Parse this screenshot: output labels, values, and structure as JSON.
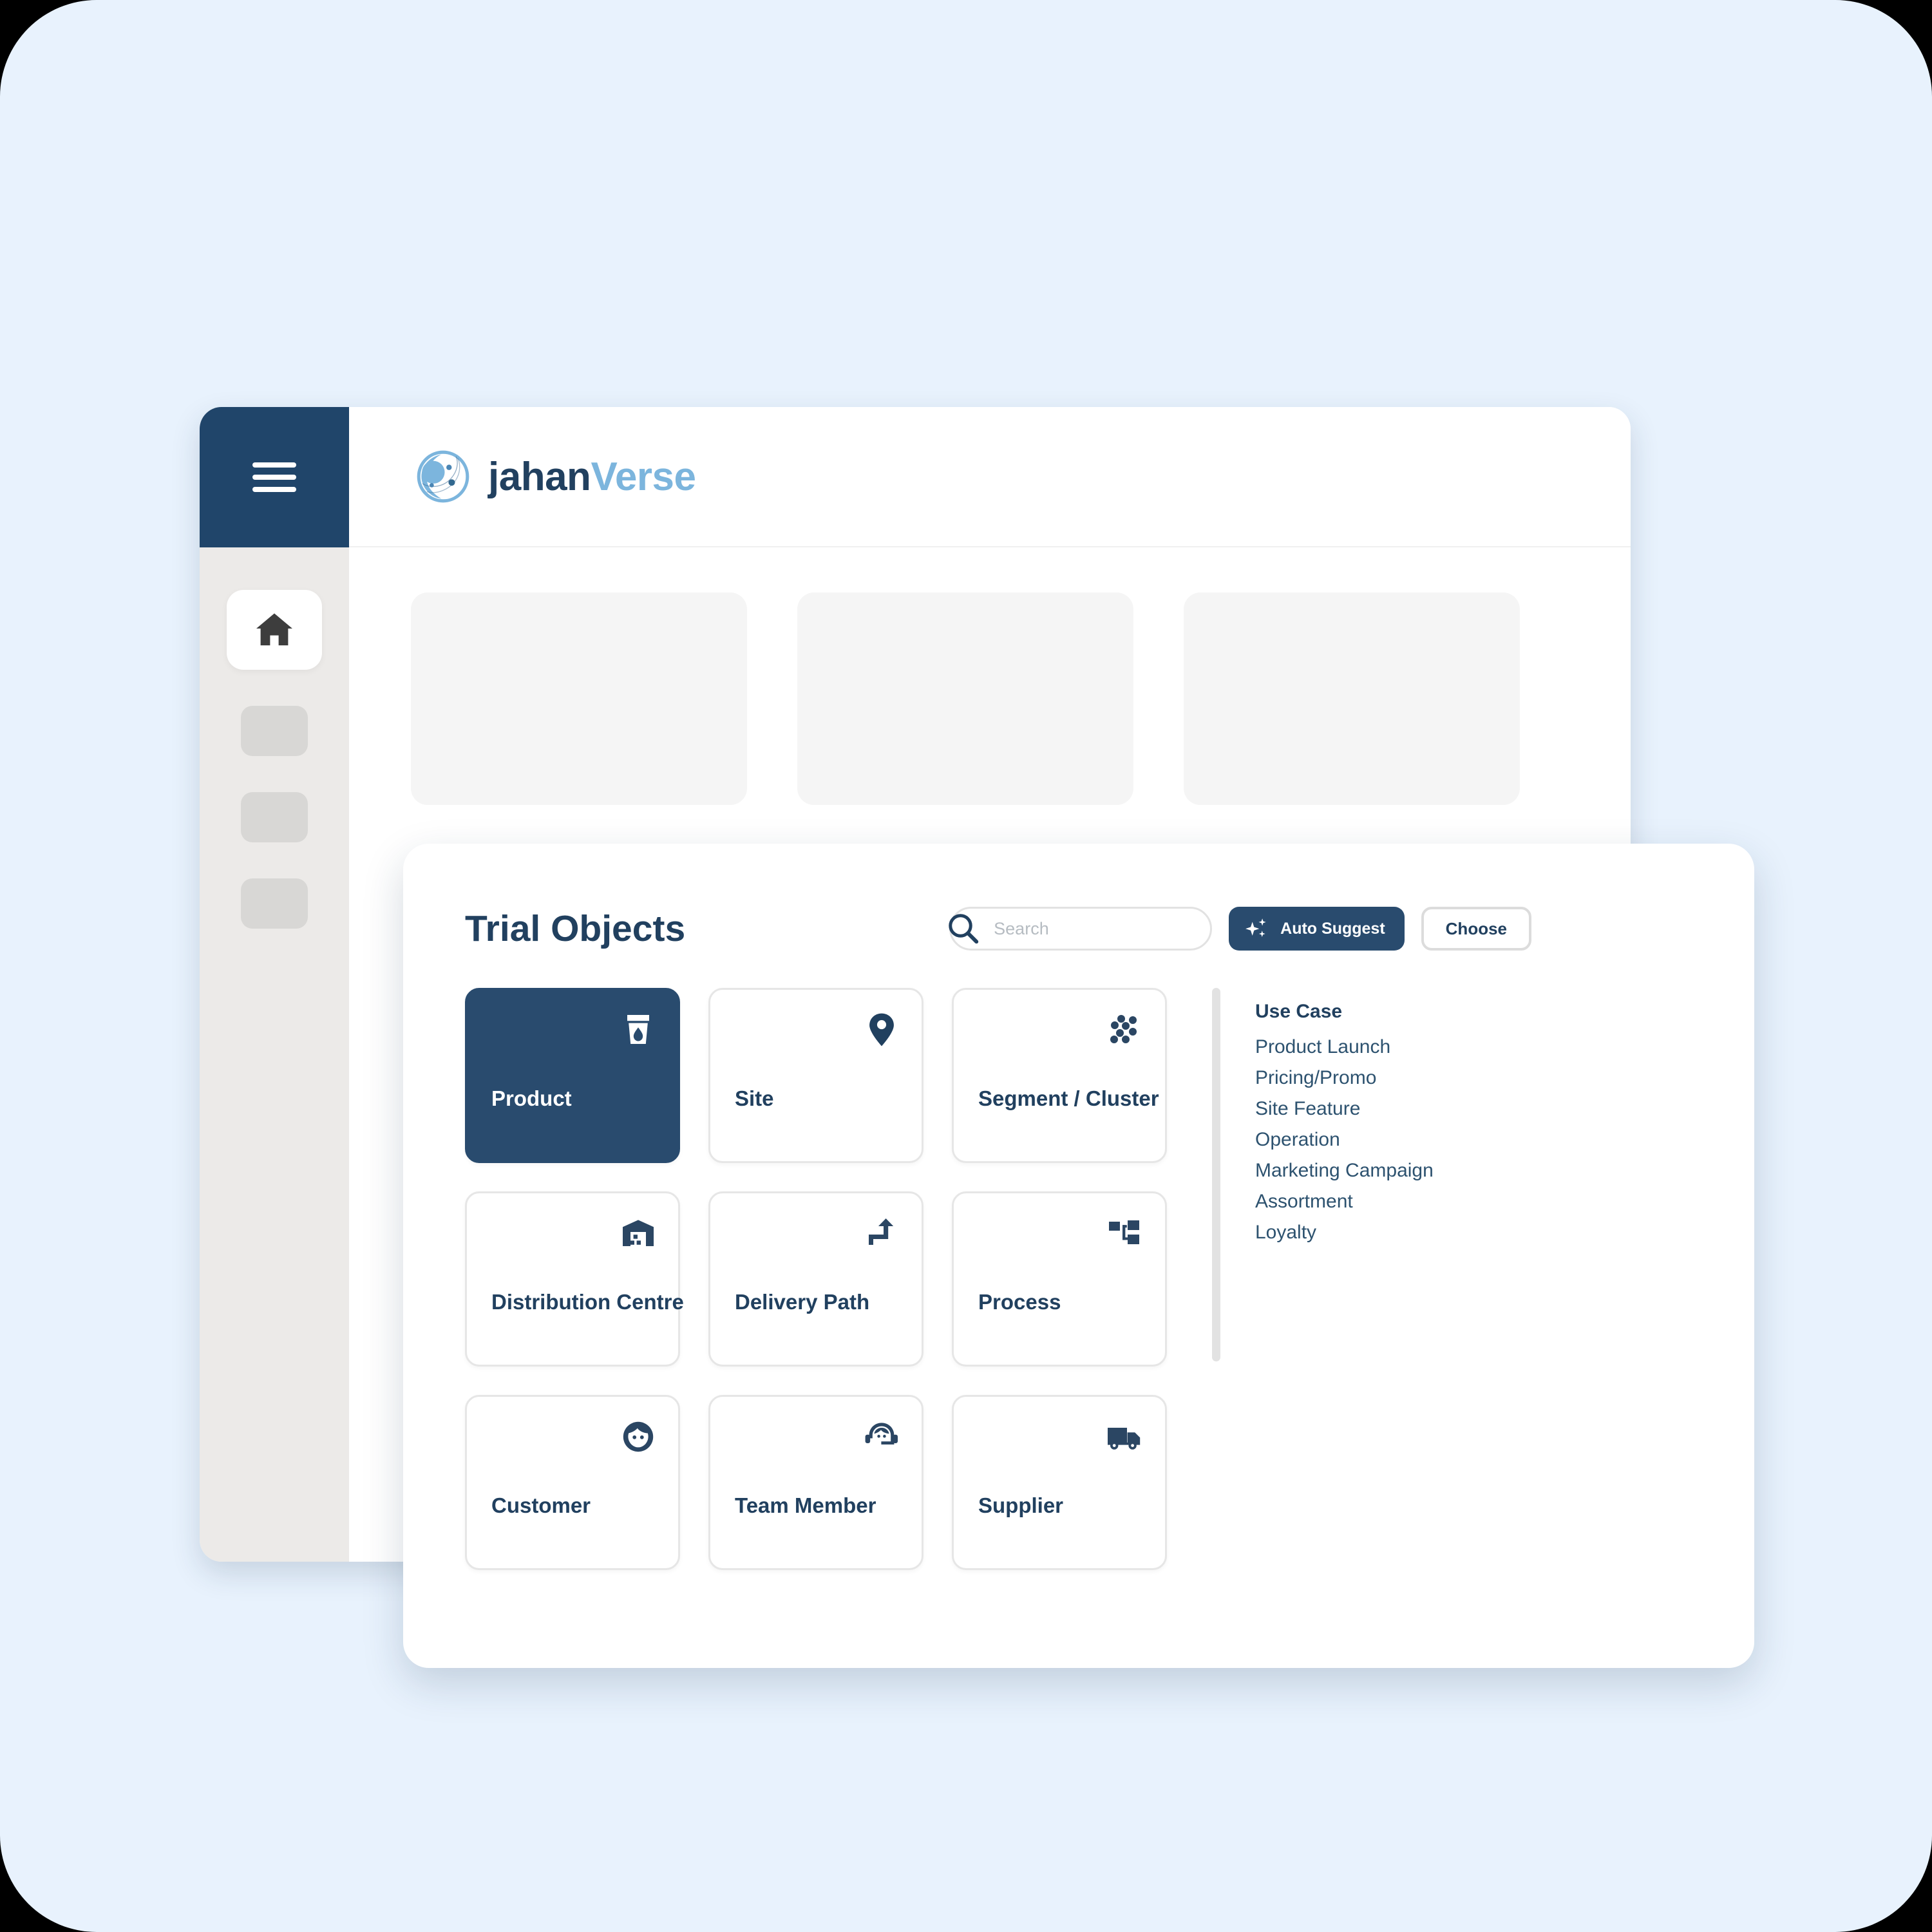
{
  "colors": {
    "page_background": "#e8f2fd",
    "brand_dark": "#21405f",
    "brand_light": "#7cb5dd",
    "accent_navy": "#294b6e",
    "sidebar_rail": "#eceae8",
    "skeleton": "#f5f5f5"
  },
  "app": {
    "brand": {
      "name_part_one": "jahan",
      "name_part_two": "Verse",
      "logo_icon": "crescent-moon-orbit-icon"
    },
    "sidebar": {
      "menu_icon": "hamburger-menu-icon",
      "items": [
        {
          "icon": "home-icon",
          "active": true
        },
        {
          "icon": "placeholder-icon",
          "active": false
        },
        {
          "icon": "placeholder-icon",
          "active": false
        },
        {
          "icon": "placeholder-icon",
          "active": false
        }
      ]
    },
    "skeleton_cards": [
      {},
      {},
      {}
    ]
  },
  "modal": {
    "title": "Trial Objects",
    "search": {
      "placeholder": "Search",
      "value": "",
      "icon": "search-icon"
    },
    "auto_suggest_label": "Auto Suggest",
    "auto_suggest_icon": "sparkle-icon",
    "choose_label": "Choose",
    "objects": [
      {
        "label": "Product",
        "icon": "cup-water-drop-icon",
        "selected": true
      },
      {
        "label": "Site",
        "icon": "location-pin-icon",
        "selected": false
      },
      {
        "label": "Segment / Cluster",
        "icon": "dot-cluster-icon",
        "selected": false
      },
      {
        "label": "Distribution Centre",
        "icon": "warehouse-icon",
        "selected": false
      },
      {
        "label": "Delivery Path",
        "icon": "route-arrow-icon",
        "selected": false
      },
      {
        "label": "Process",
        "icon": "sitemap-icon",
        "selected": false
      },
      {
        "label": "Customer",
        "icon": "person-face-icon",
        "selected": false
      },
      {
        "label": "Team Member",
        "icon": "headset-agent-icon",
        "selected": false
      },
      {
        "label": "Supplier",
        "icon": "delivery-truck-icon",
        "selected": false
      }
    ],
    "use_case": {
      "title": "Use Case",
      "items": [
        "Product Launch",
        "Pricing/Promo",
        "Site Feature",
        "Operation",
        "Marketing Campaign",
        "Assortment",
        "Loyalty"
      ]
    }
  }
}
